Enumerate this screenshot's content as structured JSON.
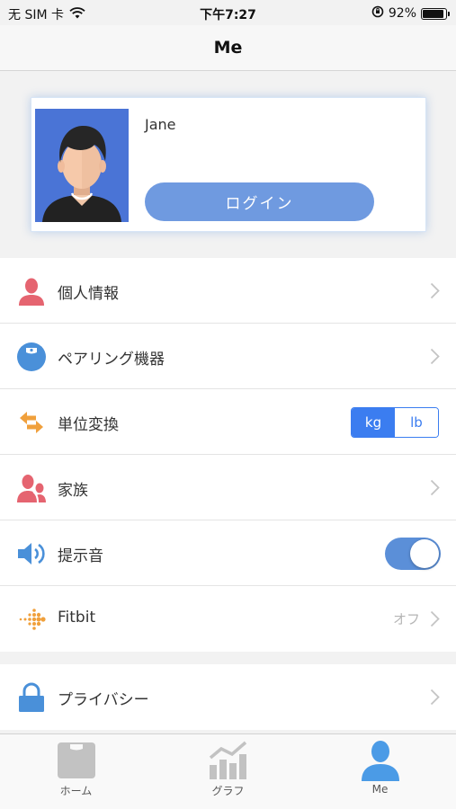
{
  "status_bar": {
    "carrier": "无 SIM 卡",
    "time": "下午7:27",
    "battery_percent": "92%",
    "battery_level": 0.92
  },
  "nav": {
    "title": "Me"
  },
  "profile": {
    "name": "Jane",
    "login_label": "ログイン"
  },
  "menu": {
    "personal_info": "個人情報",
    "pairing": "ペアリング機器",
    "unit": {
      "label": "単位変換",
      "options": [
        "kg",
        "lb"
      ],
      "selected": "kg"
    },
    "family": "家族",
    "sound": {
      "label": "提示音",
      "enabled": true
    },
    "fitbit": {
      "label": "Fitbit",
      "value": "オフ"
    },
    "privacy": "プライバシー"
  },
  "tabs": [
    {
      "label": "ホーム",
      "active": false
    },
    {
      "label": "グラフ",
      "active": false
    },
    {
      "label": "Me",
      "active": true
    }
  ],
  "colors": {
    "accent_blue": "#3b7df0",
    "login_button": "#6f9ae0",
    "switch_on": "#5b8fd8",
    "icon_red": "#e56470",
    "icon_orange": "#f0a03c",
    "tab_active": "#4b9be6",
    "tab_inactive": "#c2c2c2"
  }
}
